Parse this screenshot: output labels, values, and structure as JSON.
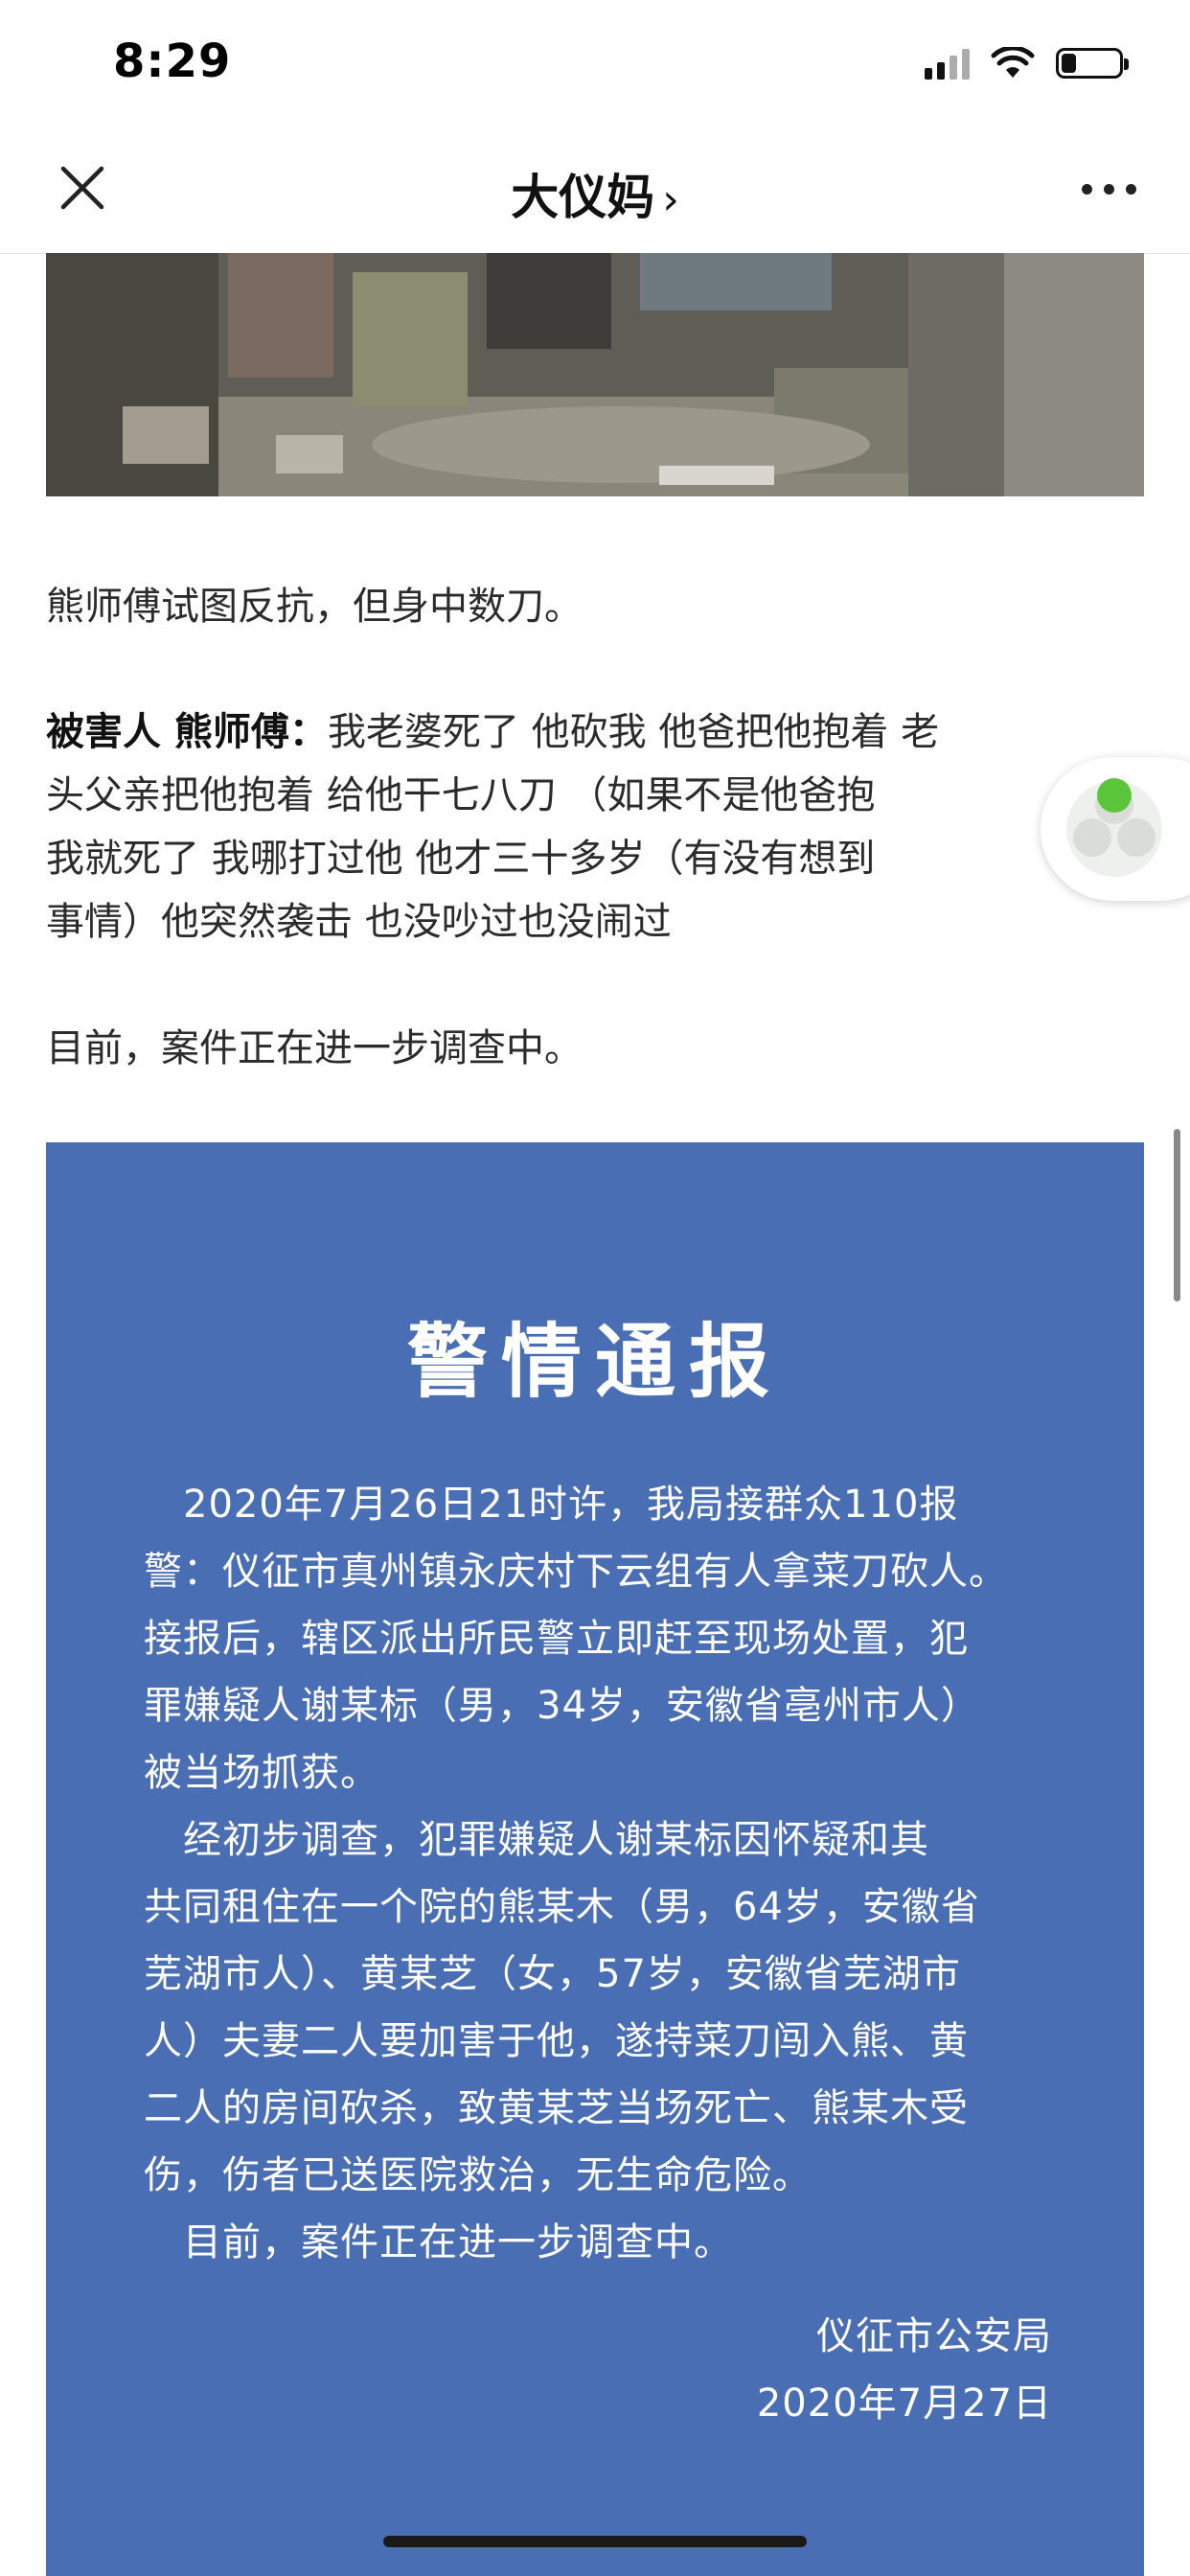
{
  "status_bar": {
    "time": "8:29",
    "battery_level": 0.25
  },
  "nav": {
    "title": "大仪妈",
    "chevron": "›",
    "close_icon": "close-icon",
    "more_icon": "more-icon"
  },
  "article": {
    "p1": "熊师傅试图反抗，但身中数刀。",
    "p2_speaker": "被害人 熊师傅：",
    "p2_line1": "我老婆死了 他砍我 他爸把他抱着 老",
    "p2_line2": "头父亲把他抱着 给他干七八刀 （如果不是他爸抱",
    "p2_line3": "我就死了 我哪打过他 他才三十多岁（有没有想到",
    "p2_line4": "事情）他突然袭击 也没吵过也没闹过",
    "p3": "目前，案件正在进一步调查中。"
  },
  "notice": {
    "title": "警情通报",
    "lines": [
      "　2020年7月26日21时许，我局接群众110报",
      "警：仪征市真州镇永庆村下云组有人拿菜刀砍人。",
      "接报后，辖区派出所民警立即赶至现场处置，犯",
      "罪嫌疑人谢某标（男，34岁，安徽省亳州市人）",
      "被当场抓获。",
      "　经初步调查，犯罪嫌疑人谢某标因怀疑和其",
      "共同租住在一个院的熊某木（男，64岁，安徽省",
      "芜湖市人）、黄某芝（女，57岁，安徽省芜湖市",
      "人）夫妻二人要加害于他，遂持菜刀闯入熊、黄",
      "二人的房间砍杀，致黄某芝当场死亡、熊某木受",
      "伤，伤者已送医院救治，无生命危险。",
      "　目前，案件正在进一步调查中。"
    ],
    "signature": "仪征市公安局",
    "date": "2020年7月27日"
  },
  "colors": {
    "notice_bg": "#4a6eb3",
    "text": "#2b2b2b",
    "widget_green": "#5cc63a"
  }
}
